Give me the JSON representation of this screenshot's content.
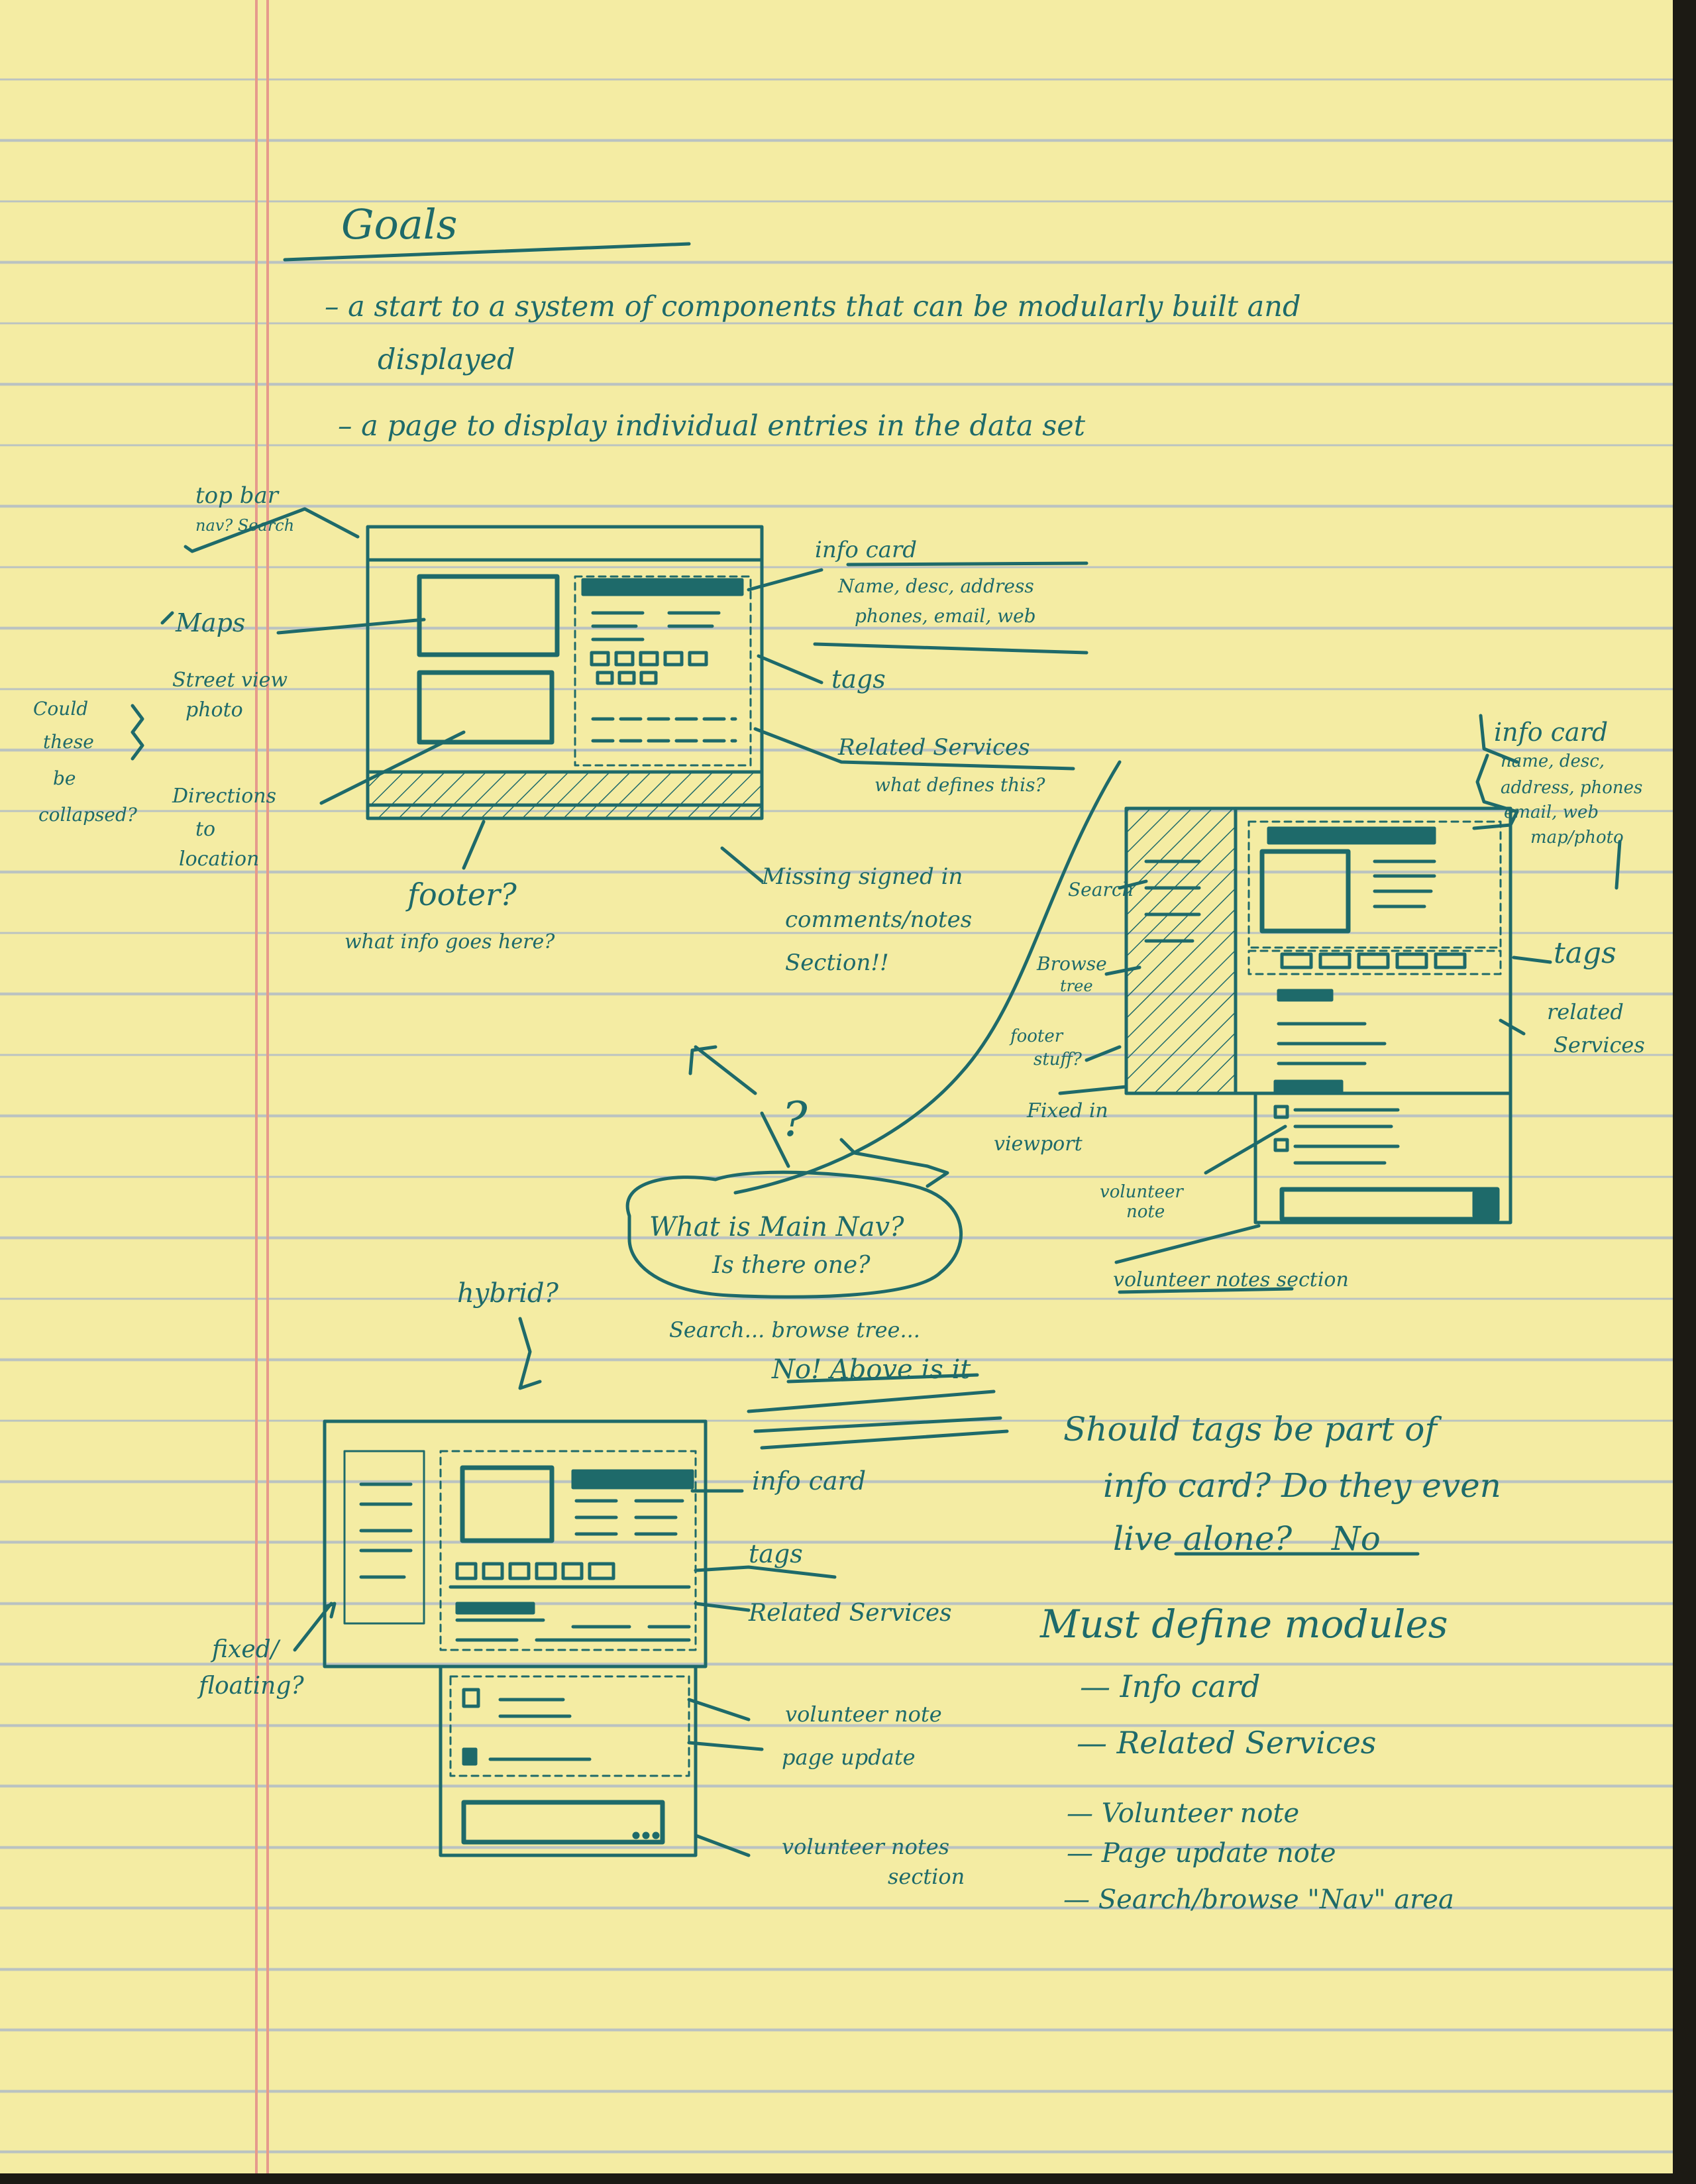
{
  "heading": "Goals",
  "goals": [
    "– a start to a system of components that can be modularly built and",
    "displayed",
    "– a page to display individual entries in the data set"
  ],
  "sketch1": {
    "topbar": "top bar",
    "topbar_sub": "nav? Search",
    "maps": "Maps",
    "street_view": "Street view",
    "photo": "photo",
    "collapse_note": [
      "Could",
      "these",
      "be",
      "collapsed?"
    ],
    "directions": "Directions",
    "to_location": "to",
    "location": "location",
    "info_card": "info card",
    "info_card_fields": "Name, desc, address",
    "info_card_fields2": "phones, email, web",
    "tags": "tags",
    "related": "Related Services",
    "related_q": "what defines this?",
    "footer": "footer?",
    "footer_q": "what info goes here?",
    "missing": [
      "Missing signed in",
      "comments/notes",
      "Section!!"
    ]
  },
  "sketch2": {
    "info_card": "info card",
    "info_fields": [
      "name, desc,",
      "address, phones",
      "email, web",
      "map/photo"
    ],
    "search": "Search",
    "browse": "Browse",
    "tree": "tree",
    "footer_stuff": "footer",
    "footer_stuff2": "stuff?",
    "fixed": "Fixed in",
    "viewport": "viewport",
    "tags": "tags",
    "related": "related",
    "services": "Services",
    "volunteer_note": "volunteer",
    "note": "note",
    "volunteer_section": "volunteer notes section"
  },
  "center": {
    "question": "?",
    "main_nav": "What is Main Nav?",
    "is_there": "Is there one?",
    "search_browse": "Search... browse tree...",
    "answer": "No! Above is it",
    "hybrid": "hybrid?"
  },
  "sketch3": {
    "info_card": "info card",
    "tags": "tags",
    "related": "Related Services",
    "fixed_floating": "fixed/",
    "floating": "floating?",
    "volunteer_note": "volunteer note",
    "page_update": "page update",
    "volunteer_notes": "volunteer notes",
    "section": "section"
  },
  "questions": {
    "line1": "Should tags be part of",
    "line2": "info card? Do they even",
    "line3": "live alone?",
    "answer": "No"
  },
  "modules": {
    "title": "Must define modules",
    "items": [
      "— Info card",
      "— Related Services",
      "— Volunteer note",
      "— Page update note",
      "— Search/browse \"Nav\" area"
    ]
  },
  "colors": {
    "paper": "#f4eca3",
    "rule": "#b9c2c2",
    "margin": "#e69a8c",
    "ink": "#1e6a6a"
  }
}
